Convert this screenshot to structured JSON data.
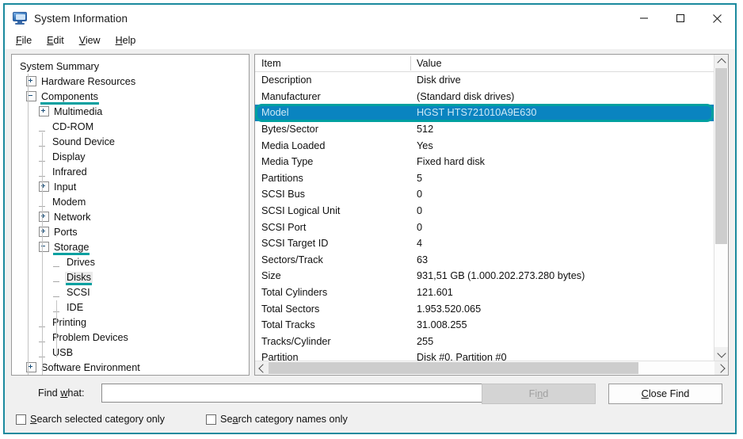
{
  "window": {
    "title": "System Information",
    "icon": "computer-monitor-icon",
    "accent_border_color": "#1b8a9e",
    "controls": {
      "minimize": "–",
      "maximize": "□",
      "close": "✕"
    }
  },
  "menu": {
    "items": [
      {
        "label": "File",
        "accel": "F"
      },
      {
        "label": "Edit",
        "accel": "E"
      },
      {
        "label": "View",
        "accel": "V"
      },
      {
        "label": "Help",
        "accel": "H"
      }
    ]
  },
  "tree": {
    "annotation_color": "#00a0a0",
    "nodes": [
      {
        "label": "System Summary",
        "indent": 0,
        "toggle": "none",
        "selected": false,
        "underline": false
      },
      {
        "label": "Hardware Resources",
        "indent": 1,
        "toggle": "plus",
        "selected": false,
        "underline": false
      },
      {
        "label": "Components",
        "indent": 1,
        "toggle": "minus",
        "selected": false,
        "underline": true
      },
      {
        "label": "Multimedia",
        "indent": 2,
        "toggle": "plus",
        "selected": false,
        "underline": false
      },
      {
        "label": "CD-ROM",
        "indent": 2,
        "toggle": "leaf",
        "selected": false,
        "underline": false
      },
      {
        "label": "Sound Device",
        "indent": 2,
        "toggle": "leaf",
        "selected": false,
        "underline": false
      },
      {
        "label": "Display",
        "indent": 2,
        "toggle": "leaf",
        "selected": false,
        "underline": false
      },
      {
        "label": "Infrared",
        "indent": 2,
        "toggle": "leaf",
        "selected": false,
        "underline": false
      },
      {
        "label": "Input",
        "indent": 2,
        "toggle": "plus",
        "selected": false,
        "underline": false
      },
      {
        "label": "Modem",
        "indent": 2,
        "toggle": "leaf",
        "selected": false,
        "underline": false
      },
      {
        "label": "Network",
        "indent": 2,
        "toggle": "plus",
        "selected": false,
        "underline": false
      },
      {
        "label": "Ports",
        "indent": 2,
        "toggle": "plus",
        "selected": false,
        "underline": false
      },
      {
        "label": "Storage",
        "indent": 2,
        "toggle": "minus",
        "selected": false,
        "underline": true
      },
      {
        "label": "Drives",
        "indent": 3,
        "toggle": "leaf",
        "selected": false,
        "underline": false
      },
      {
        "label": "Disks",
        "indent": 3,
        "toggle": "leaf",
        "selected": true,
        "underline": true
      },
      {
        "label": "SCSI",
        "indent": 3,
        "toggle": "leaf",
        "selected": false,
        "underline": false
      },
      {
        "label": "IDE",
        "indent": 3,
        "toggle": "leaf",
        "selected": false,
        "underline": false
      },
      {
        "label": "Printing",
        "indent": 2,
        "toggle": "leaf",
        "selected": false,
        "underline": false
      },
      {
        "label": "Problem Devices",
        "indent": 2,
        "toggle": "leaf",
        "selected": false,
        "underline": false
      },
      {
        "label": "USB",
        "indent": 2,
        "toggle": "leaf",
        "selected": false,
        "underline": false
      },
      {
        "label": "Software Environment",
        "indent": 1,
        "toggle": "plus",
        "selected": false,
        "underline": false
      }
    ]
  },
  "details": {
    "columns": [
      "Item",
      "Value"
    ],
    "selection_color": "#0a84c0",
    "annotation_color": "#00a0a0",
    "rows": [
      {
        "item": "Description",
        "value": "Disk drive",
        "selected": false
      },
      {
        "item": "Manufacturer",
        "value": "(Standard disk drives)",
        "selected": false
      },
      {
        "item": "Model",
        "value": "HGST HTS721010A9E630",
        "selected": true
      },
      {
        "item": "Bytes/Sector",
        "value": "512",
        "selected": false
      },
      {
        "item": "Media Loaded",
        "value": "Yes",
        "selected": false
      },
      {
        "item": "Media Type",
        "value": "Fixed hard disk",
        "selected": false
      },
      {
        "item": "Partitions",
        "value": "5",
        "selected": false
      },
      {
        "item": "SCSI Bus",
        "value": "0",
        "selected": false
      },
      {
        "item": "SCSI Logical Unit",
        "value": "0",
        "selected": false
      },
      {
        "item": "SCSI Port",
        "value": "0",
        "selected": false
      },
      {
        "item": "SCSI Target ID",
        "value": "4",
        "selected": false
      },
      {
        "item": "Sectors/Track",
        "value": "63",
        "selected": false
      },
      {
        "item": "Size",
        "value": "931,51 GB (1.000.202.273.280 bytes)",
        "selected": false
      },
      {
        "item": "Total Cylinders",
        "value": "121.601",
        "selected": false
      },
      {
        "item": "Total Sectors",
        "value": "1.953.520.065",
        "selected": false
      },
      {
        "item": "Total Tracks",
        "value": "31.008.255",
        "selected": false
      },
      {
        "item": "Tracks/Cylinder",
        "value": "255",
        "selected": false
      },
      {
        "item": "Partition",
        "value": "Disk #0, Partition #0",
        "selected": false
      }
    ]
  },
  "find": {
    "label": "Find what:",
    "label_accel": "w",
    "input_value": "",
    "input_placeholder": "",
    "find_button": "Find",
    "find_button_accel": "n",
    "find_button_enabled": false,
    "close_button": "Close Find",
    "close_button_accel": "C",
    "checkbox_selected_category": "Search selected category only",
    "checkbox_selected_category_accel": "S",
    "checkbox_selected_category_checked": false,
    "checkbox_category_names": "Search category names only",
    "checkbox_category_names_accel": "a",
    "checkbox_category_names_checked": false
  }
}
